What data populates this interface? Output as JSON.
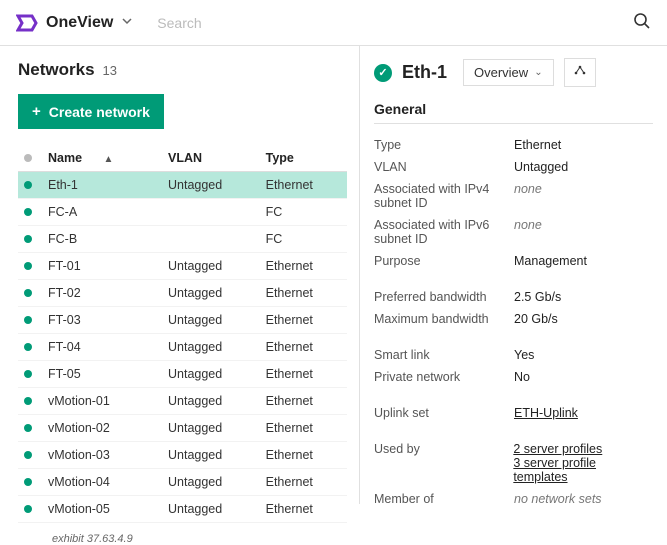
{
  "header": {
    "app_name": "OneView",
    "search_placeholder": "Search"
  },
  "list": {
    "title": "Networks",
    "count": "13",
    "create_label": "Create network",
    "columns": {
      "name": "Name",
      "vlan": "VLAN",
      "type": "Type"
    },
    "rows": [
      {
        "name": "Eth-1",
        "vlan": "Untagged",
        "type": "Ethernet",
        "selected": true
      },
      {
        "name": "FC-A",
        "vlan": "",
        "type": "FC"
      },
      {
        "name": "FC-B",
        "vlan": "",
        "type": "FC"
      },
      {
        "name": "FT-01",
        "vlan": "Untagged",
        "type": "Ethernet"
      },
      {
        "name": "FT-02",
        "vlan": "Untagged",
        "type": "Ethernet"
      },
      {
        "name": "FT-03",
        "vlan": "Untagged",
        "type": "Ethernet"
      },
      {
        "name": "FT-04",
        "vlan": "Untagged",
        "type": "Ethernet"
      },
      {
        "name": "FT-05",
        "vlan": "Untagged",
        "type": "Ethernet"
      },
      {
        "name": "vMotion-01",
        "vlan": "Untagged",
        "type": "Ethernet"
      },
      {
        "name": "vMotion-02",
        "vlan": "Untagged",
        "type": "Ethernet"
      },
      {
        "name": "vMotion-03",
        "vlan": "Untagged",
        "type": "Ethernet"
      },
      {
        "name": "vMotion-04",
        "vlan": "Untagged",
        "type": "Ethernet"
      },
      {
        "name": "vMotion-05",
        "vlan": "Untagged",
        "type": "Ethernet"
      }
    ],
    "exhibit": "exhibit 37.63.4.9"
  },
  "detail": {
    "title": "Eth-1",
    "view_selector": "Overview",
    "section": "General",
    "groups": [
      [
        {
          "key": "Type",
          "val": "Ethernet"
        },
        {
          "key": "VLAN",
          "val": "Untagged"
        },
        {
          "key": "Associated with IPv4 subnet ID",
          "val": "none",
          "style": "italic"
        },
        {
          "key": "Associated with IPv6 subnet ID",
          "val": "none",
          "style": "italic"
        },
        {
          "key": "Purpose",
          "val": "Management"
        }
      ],
      [
        {
          "key": "Preferred bandwidth",
          "val": "2.5 Gb/s"
        },
        {
          "key": "Maximum bandwidth",
          "val": "20 Gb/s"
        }
      ],
      [
        {
          "key": "Smart link",
          "val": "Yes"
        },
        {
          "key": "Private network",
          "val": "No"
        }
      ],
      [
        {
          "key": "Uplink set",
          "val": "ETH-Uplink",
          "style": "link"
        }
      ],
      [
        {
          "key": "Used by",
          "val": "2 server profiles\n3 server profile templates",
          "style": "multilink"
        },
        {
          "key": "Member of",
          "val": "no network sets",
          "style": "italic"
        }
      ]
    ]
  }
}
